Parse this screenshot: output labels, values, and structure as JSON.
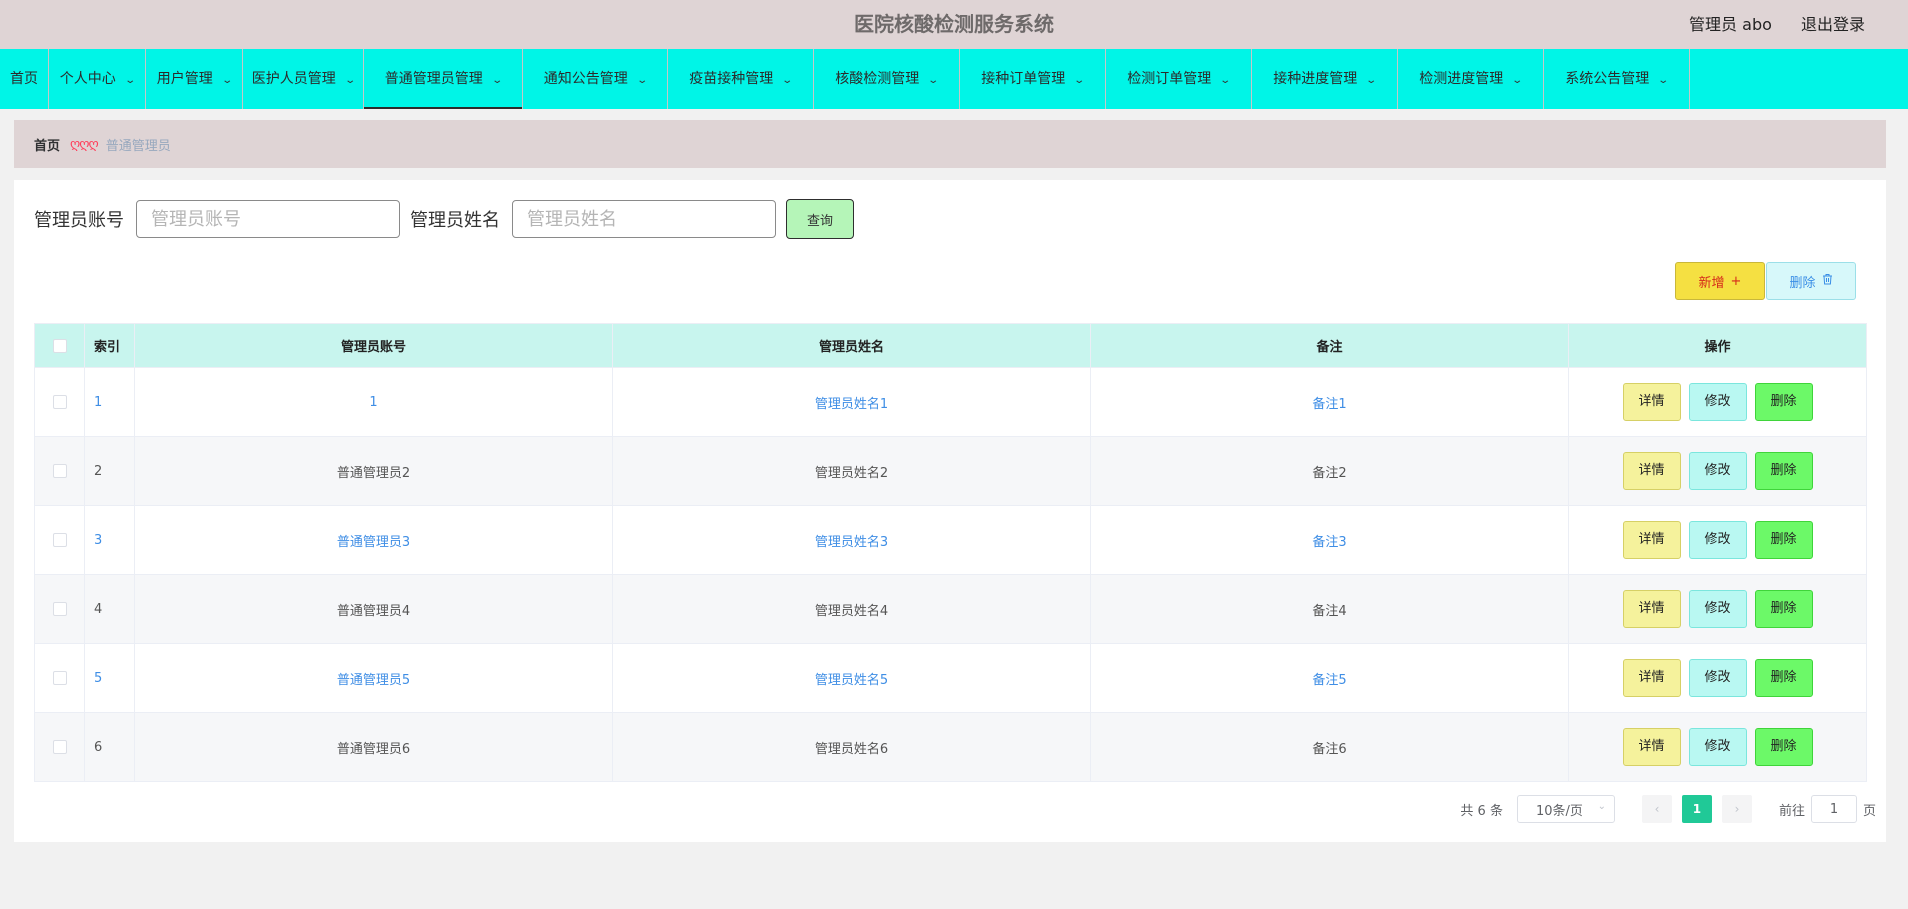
{
  "header": {
    "title": "医院核酸检测服务系统",
    "user_label": "管理员 abo",
    "logout_label": "退出登录"
  },
  "nav": {
    "items": [
      {
        "label": "首页",
        "has_dropdown": false
      },
      {
        "label": "个人中心",
        "has_dropdown": true
      },
      {
        "label": "用户管理",
        "has_dropdown": true
      },
      {
        "label": "医护人员管理",
        "has_dropdown": true
      },
      {
        "label": "普通管理员管理",
        "has_dropdown": true,
        "active": true
      },
      {
        "label": "通知公告管理",
        "has_dropdown": true
      },
      {
        "label": "疫苗接种管理",
        "has_dropdown": true
      },
      {
        "label": "核酸检测管理",
        "has_dropdown": true
      },
      {
        "label": "接种订单管理",
        "has_dropdown": true
      },
      {
        "label": "检测订单管理",
        "has_dropdown": true
      },
      {
        "label": "接种进度管理",
        "has_dropdown": true
      },
      {
        "label": "检测进度管理",
        "has_dropdown": true
      },
      {
        "label": "系统公告管理",
        "has_dropdown": true
      }
    ]
  },
  "breadcrumb": {
    "home": "首页",
    "separator": "ღღღ",
    "current": "普通管理员"
  },
  "search": {
    "account_label": "管理员账号",
    "account_placeholder": "管理员账号",
    "name_label": "管理员姓名",
    "name_placeholder": "管理员姓名",
    "query_label": "查询"
  },
  "toolbar": {
    "add_label": "新增",
    "delete_label": "删除"
  },
  "table": {
    "headers": {
      "index": "索引",
      "account": "管理员账号",
      "name": "管理员姓名",
      "remark": "备注",
      "actions": "操作"
    },
    "rows": [
      {
        "index": "1",
        "account": "1",
        "name": "管理员姓名1",
        "remark": "备注1"
      },
      {
        "index": "2",
        "account": "普通管理员2",
        "name": "管理员姓名2",
        "remark": "备注2"
      },
      {
        "index": "3",
        "account": "普通管理员3",
        "name": "管理员姓名3",
        "remark": "备注3"
      },
      {
        "index": "4",
        "account": "普通管理员4",
        "name": "管理员姓名4",
        "remark": "备注4"
      },
      {
        "index": "5",
        "account": "普通管理员5",
        "name": "管理员姓名5",
        "remark": "备注5"
      },
      {
        "index": "6",
        "account": "普通管理员6",
        "name": "管理员姓名6",
        "remark": "备注6"
      }
    ],
    "action_labels": {
      "detail": "详情",
      "edit": "修改",
      "delete": "删除"
    }
  },
  "pagination": {
    "total": "共 6 条",
    "page_size": "10条/页",
    "current_page": "1",
    "goto_prefix": "前往",
    "goto_value": "1",
    "goto_suffix": "页"
  },
  "colors": {
    "nav_bg": "#00f5e7",
    "header_bg": "#dfd4d5",
    "table_header_bg": "#c8f5ee",
    "link_blue": "#3f8ee5",
    "active_page": "#20c997"
  }
}
